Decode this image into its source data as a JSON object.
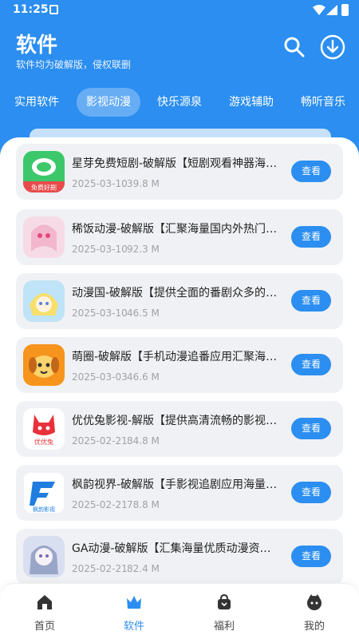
{
  "status": {
    "time": "11:25"
  },
  "header": {
    "title": "软件",
    "subtitle": "软件均为破解版，侵权联删"
  },
  "tabs": [
    {
      "label": "实用软件"
    },
    {
      "label": "影视动漫",
      "active": true
    },
    {
      "label": "快乐源泉"
    },
    {
      "label": "游戏辅助"
    },
    {
      "label": "畅听音乐"
    }
  ],
  "apps": [
    {
      "name": "星芽免费短剧-破解版【短剧观看神器海量短剧",
      "date": "2025-03-10",
      "size": "39.8 M",
      "button": "查看",
      "icon_label": "免费好剧"
    },
    {
      "name": "稀饭动漫-破解版【汇聚海量国内外热门动漫",
      "date": "2025-03-10",
      "size": "92.3 M",
      "button": "查看"
    },
    {
      "name": "动漫国-破解版【提供全面的番剧众多的动漫",
      "date": "2025-03-10",
      "size": "46.5 M",
      "button": "查看"
    },
    {
      "name": "萌圈-破解版【手机动漫追番应用汇聚海量动漫",
      "date": "2025-03-03",
      "size": "46.6 M",
      "button": "查看"
    },
    {
      "name": "优优兔影视-解版【提供高清流畅的影视资源",
      "date": "2025-02-21",
      "size": "84.8 M",
      "button": "查看",
      "icon_label": "优优兔"
    },
    {
      "name": "枫韵视界-破解版【手影视追剧应用海量影视",
      "date": "2025-02-21",
      "size": "78.8 M",
      "button": "查看",
      "icon_label": "枫韵影视"
    },
    {
      "name": "GA动漫-破解版【汇集海量优质动漫资源的应用",
      "date": "2025-02-21",
      "size": "82.4 M",
      "button": "查看"
    }
  ],
  "bottom_nav": [
    {
      "label": "首页",
      "icon": "home-icon"
    },
    {
      "label": "软件",
      "icon": "crown-icon",
      "active": true
    },
    {
      "label": "福利",
      "icon": "gift-bag-icon"
    },
    {
      "label": "我的",
      "icon": "profile-icon"
    }
  ],
  "colors": {
    "primary": "#2b8ef0",
    "card_bg": "#f0f1f4"
  }
}
